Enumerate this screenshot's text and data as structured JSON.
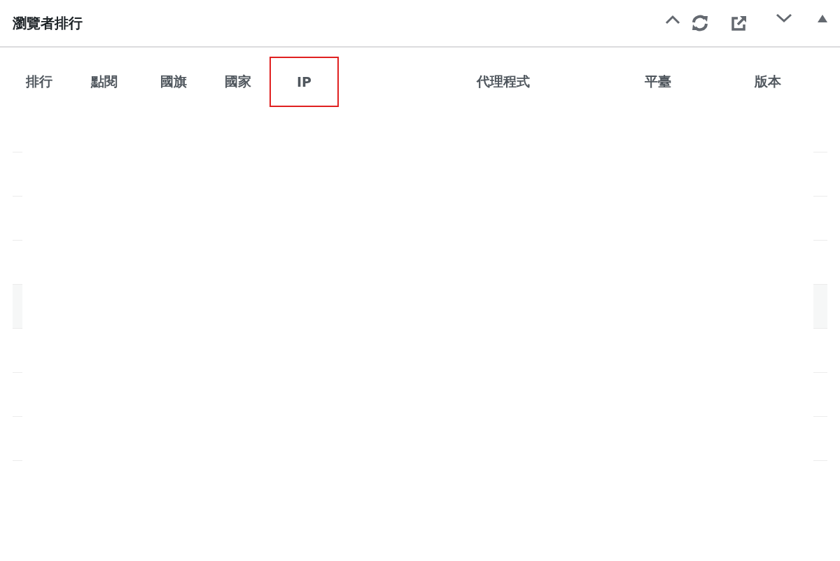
{
  "panel": {
    "title": "瀏覽者排行"
  },
  "table": {
    "columns": [
      {
        "label": "排行",
        "highlighted": false
      },
      {
        "label": "點閱",
        "highlighted": false
      },
      {
        "label": "國旗",
        "highlighted": false
      },
      {
        "label": "國家",
        "highlighted": false
      },
      {
        "label": "IP",
        "highlighted": true
      },
      {
        "label": "代理程式",
        "highlighted": false
      },
      {
        "label": "平臺",
        "highlighted": false
      },
      {
        "label": "版本",
        "highlighted": false
      }
    ]
  }
}
